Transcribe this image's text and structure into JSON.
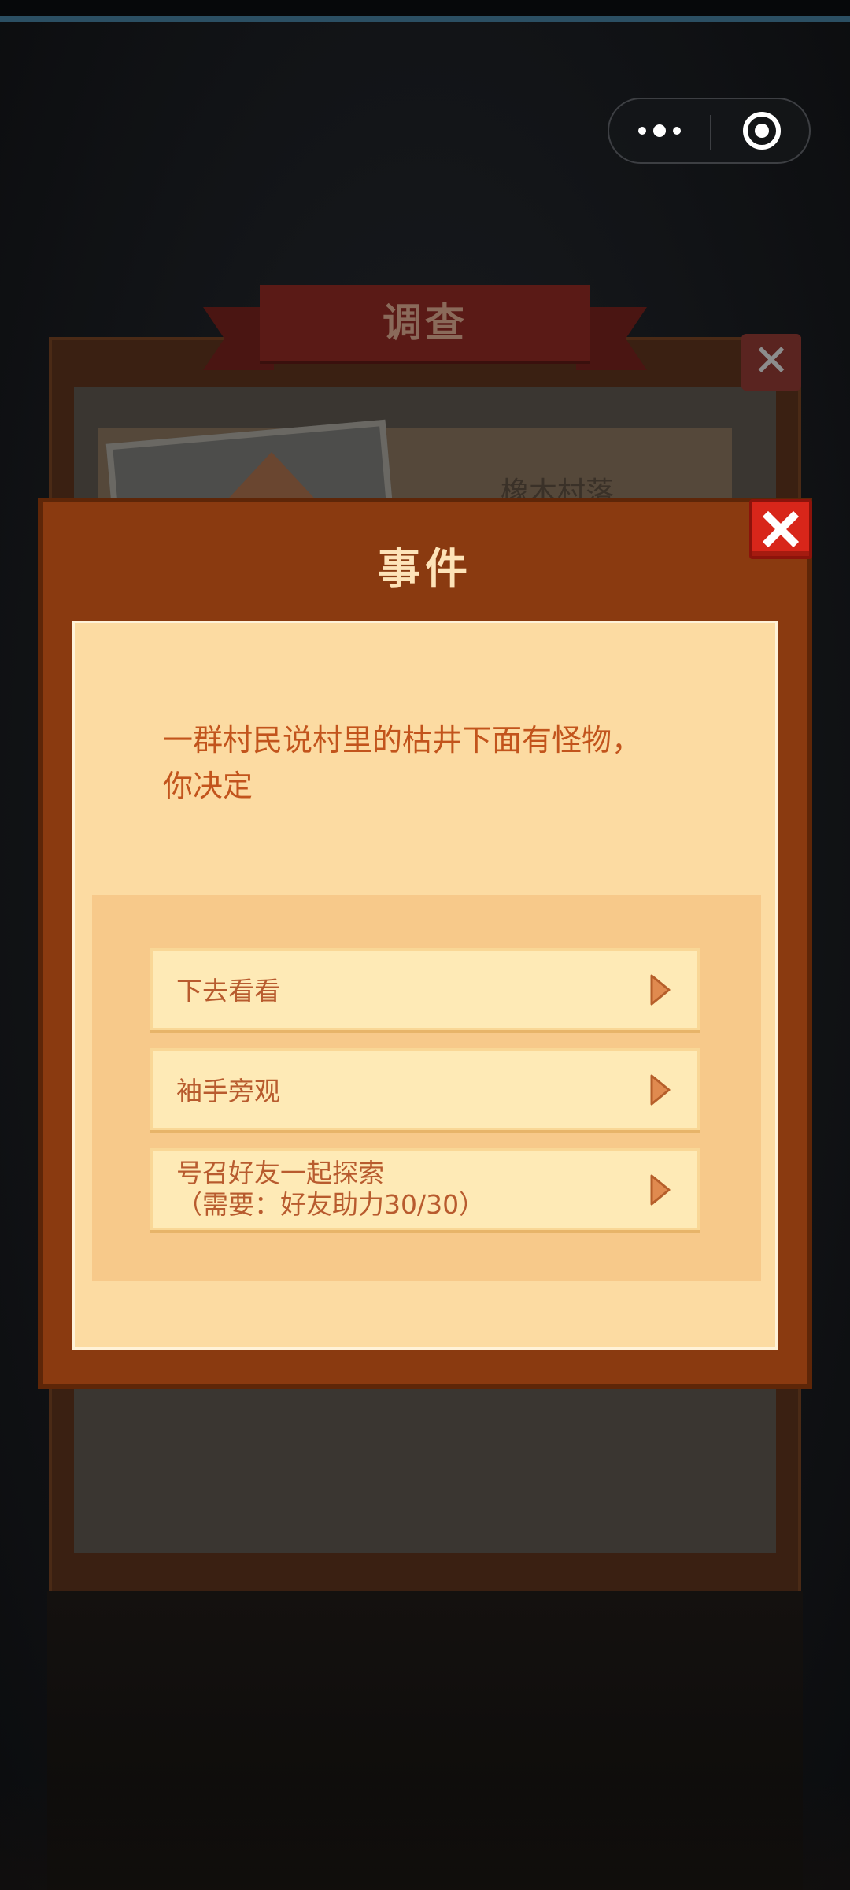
{
  "background_dialog": {
    "title": "调查",
    "location_name": "橡木村落",
    "close_icon": "close-icon"
  },
  "event_dialog": {
    "title": "事件",
    "description_line1": "一群村民说村里的枯井下面有怪物，",
    "description_line2": "你决定",
    "close_icon": "close-icon",
    "choices": [
      {
        "label": "下去看看",
        "icon": "play-arrow-icon"
      },
      {
        "label": "袖手旁观",
        "icon": "play-arrow-icon"
      },
      {
        "label_line1": "号召好友一起探索",
        "label_line2": "（需要：好友助力30/30）",
        "icon": "play-arrow-icon"
      }
    ]
  },
  "capsule": {
    "more_icon": "more-dots-icon",
    "close_icon": "target-circle-icon"
  },
  "colors": {
    "dialog_frame": "#8a3a10",
    "dialog_body": "#fcdba2",
    "choice_bg": "#feeab6",
    "text_accent": "#c2541c",
    "close_red": "#d8261a"
  }
}
